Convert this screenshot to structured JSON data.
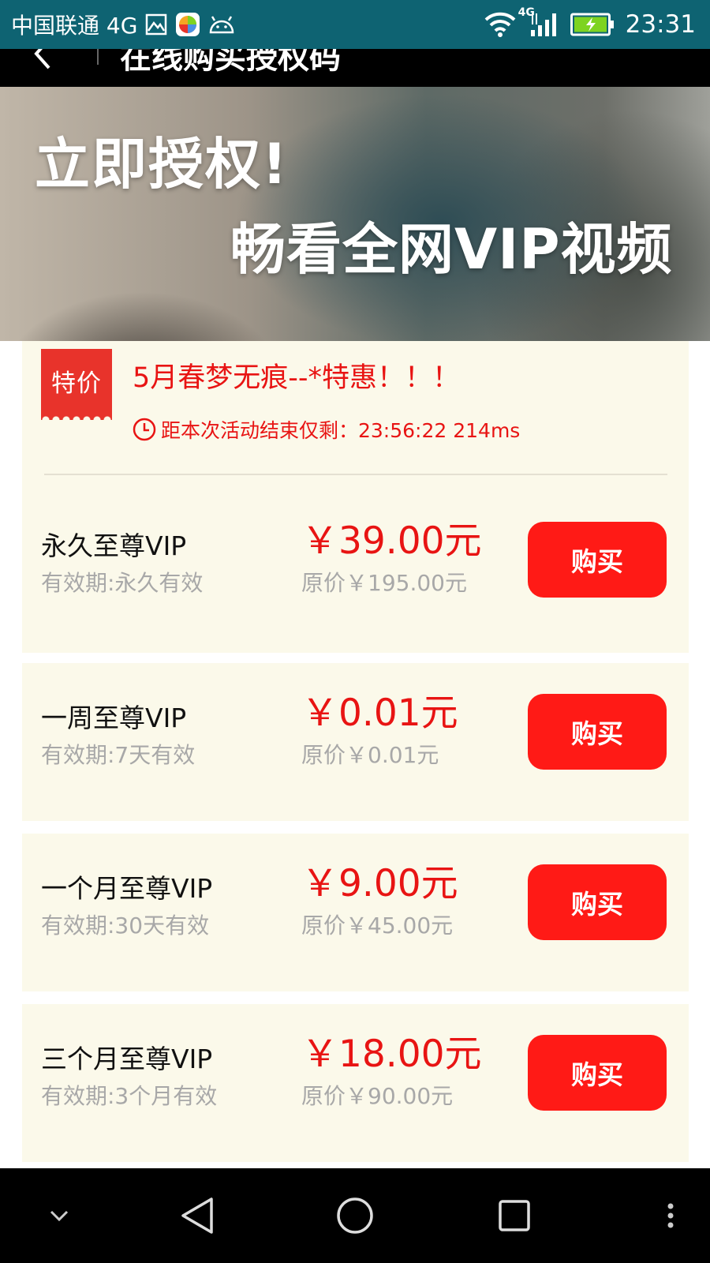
{
  "status_bar": {
    "carrier": "中国联通 4G",
    "network_label": "4G",
    "time": "23:31"
  },
  "header": {
    "title": "在线购买授权码"
  },
  "banner": {
    "line1": "立即授权!",
    "line2": "畅看全网VIP视频"
  },
  "promo": {
    "tag": "特价",
    "title": "5月春梦无痕--*特惠！！！",
    "countdown": "距本次活动结束仅剩：23:56:22 214ms"
  },
  "plans": [
    {
      "name": "永久至尊VIP",
      "validity": "有效期:永久有效",
      "price": "￥39.00元",
      "original_price": "原价￥195.00元",
      "buy_label": "购买"
    },
    {
      "name": "一周至尊VIP",
      "validity": "有效期:7天有效",
      "price": "￥0.01元",
      "original_price": "原价￥0.01元",
      "buy_label": "购买"
    },
    {
      "name": "一个月至尊VIP",
      "validity": "有效期:30天有效",
      "price": "￥9.00元",
      "original_price": "原价￥45.00元",
      "buy_label": "购买"
    },
    {
      "name": "三个月至尊VIP",
      "validity": "有效期:3个月有效",
      "price": "￥18.00元",
      "original_price": "原价￥90.00元",
      "buy_label": "购买"
    }
  ],
  "colors": {
    "accent_red": "#e81413",
    "button_red": "#ff1a16",
    "card_bg": "#fbf9ea",
    "status_bar_bg": "#0e6372"
  }
}
